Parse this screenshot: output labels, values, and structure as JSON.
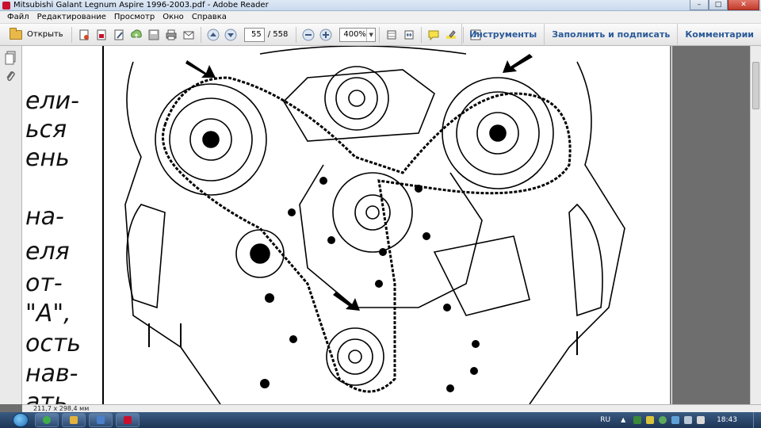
{
  "window": {
    "title": "Mitsubishi Galant Legnum Aspire 1996-2003.pdf - Adobe Reader",
    "buttons": {
      "minimize": "–",
      "maximize": "□",
      "close": "✕"
    }
  },
  "menu": [
    "Файл",
    "Редактирование",
    "Просмотр",
    "Окно",
    "Справка"
  ],
  "toolbar": {
    "open_label": "Открыть",
    "current_page": "55",
    "page_count": "/ 558",
    "zoom": "400%",
    "tools_label": "Инструменты",
    "fill_sign_label": "Заполнить и подписать",
    "comments_label": "Комментарии"
  },
  "document": {
    "text_lines": [
      "ели-",
      "ься",
      "ень",
      "на-",
      "еля",
      "от-",
      "\"A\",",
      "ость",
      "нав-",
      "ать"
    ]
  },
  "statusbar": {
    "page_size": "211,7 x 298,4 мм"
  },
  "taskbar": {
    "lang": "RU",
    "time": "18:43"
  },
  "colors": {
    "accent": "#2a5a99",
    "title_bg": "#dfe9f5",
    "taskbar": "#1d3556",
    "adobe_red": "#c8102e"
  }
}
